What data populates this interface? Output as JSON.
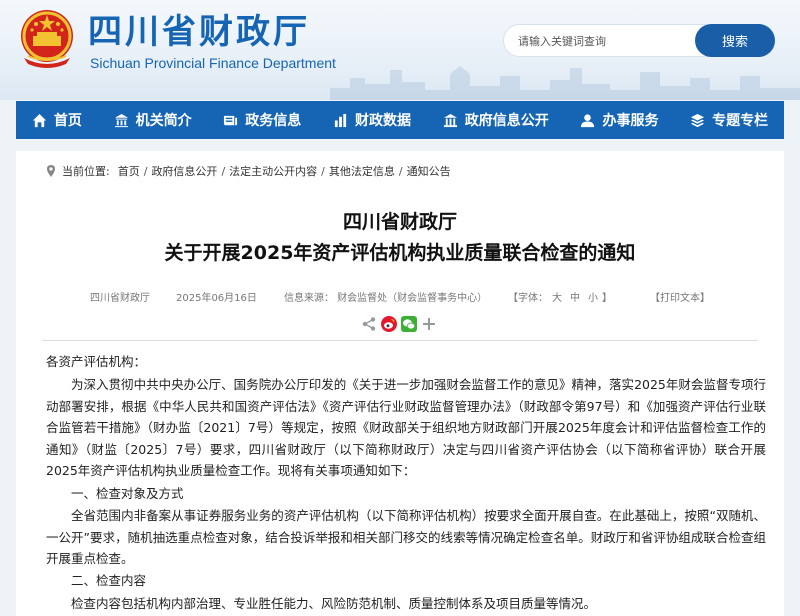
{
  "header": {
    "site_title": "四川省财政厅",
    "site_subtitle": "Sichuan Provincial Finance Department",
    "search_placeholder": "请输入关键词查询",
    "search_button": "搜索"
  },
  "nav": {
    "items": [
      {
        "label": "首页",
        "icon": "home-icon"
      },
      {
        "label": "机关简介",
        "icon": "building-icon"
      },
      {
        "label": "政务信息",
        "icon": "news-icon"
      },
      {
        "label": "财政数据",
        "icon": "chart-icon"
      },
      {
        "label": "政府信息公开",
        "icon": "bank-icon"
      },
      {
        "label": "办事服务",
        "icon": "person-icon"
      },
      {
        "label": "专题专栏",
        "icon": "layers-icon"
      }
    ]
  },
  "breadcrumb": {
    "label": "当前位置:",
    "items": [
      "首页",
      "政府信息公开",
      "法定主动公开内容",
      "其他法定信息",
      "通知公告"
    ],
    "separator": "/"
  },
  "article": {
    "title_line1": "四川省财政厅",
    "title_line2": "关于开展2025年资产评估机构执业质量联合检查的通知",
    "publisher": "四川省财政厅",
    "date": "2025年06月16日",
    "source": "信息来源：  财会监督处（财会监督事务中心）",
    "font_size_label": "【字体：",
    "font_sizes": [
      "大",
      "中",
      "小"
    ],
    "font_size_close": "】",
    "print": "【打印文本】",
    "salutation": "各资产评估机构：",
    "para1": "为深入贯彻中共中央办公厅、国务院办公厅印发的《关于进一步加强财会监督工作的意见》精神，落实2025年财会监督专项行动部署安排，根据《中华人民共和国资产评估法》《资产评估行业财政监督管理办法》（财政部令第97号）和《加强资产评估行业联合监管若干措施》（财办监〔2021〕7号）等规定，按照《财政部关于组织地方财政部门开展2025年度会计和评估监督检查工作的通知》（财监〔2025〕7号）要求，四川省财政厅（以下简称财政厅）决定与四川省资产评估协会（以下简称省评协）联合开展2025年资产评估机构执业质量检查工作。现将有关事项通知如下：",
    "heading1": "一、检查对象及方式",
    "para2": "全省范围内非备案从事证券服务业务的资产评估机构（以下简称评估机构）按要求全面开展自查。在此基础上，按照“双随机、一公开”要求，随机抽选重点检查对象，结合投诉举报和相关部门移交的线索等情况确定检查名单。财政厅和省评协组成联合检查组开展重点检查。",
    "heading2": "二、检查内容",
    "para3": "检查内容包括机构内部治理、专业胜任能力、风险防范机制、质量控制体系及项目质量等情况。"
  },
  "colors": {
    "brand_blue": "#1565b4",
    "search_button_blue": "#1a5ea8",
    "weibo_red": "#e6162d",
    "wechat_green": "#3cb034"
  }
}
